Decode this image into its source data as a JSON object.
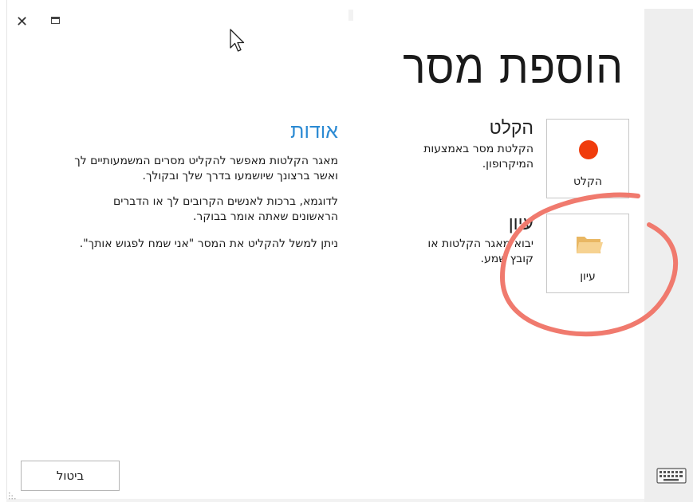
{
  "window": {
    "close_glyph": "✕"
  },
  "header": {
    "title": "הוספת מסר"
  },
  "options": [
    {
      "tile_label": "הקלט",
      "title": "הקלט",
      "description": "הקלטת מסר באמצעות המיקרופון.",
      "icon": "record-dot-icon",
      "icon_color": "#f03c0c"
    },
    {
      "tile_label": "עיון",
      "title": "עיון",
      "description": "יבוא מאגר הקלטות או קובץ שמע.",
      "icon": "folder-icon",
      "icon_color": "#f0c27a"
    }
  ],
  "about": {
    "title": "אודות",
    "paragraphs": [
      "מאגר הקלטות מאפשר להקליט מסרים המשמעותיים לך ואשר ברצונך שיושמעו בדרך שלך ובקולך.",
      "לדוגמא, ברכות לאנשים הקרובים לך או הדברים הראשונים שאתה אומר בבוקר.",
      "ניתן למשל להקליט את המסר \"אני שמח לפגוש אותך\"."
    ],
    "title_color": "#2b8ad3"
  },
  "footer": {
    "cancel_label": "ביטול"
  },
  "annotation": {
    "color": "#f07a6e"
  }
}
